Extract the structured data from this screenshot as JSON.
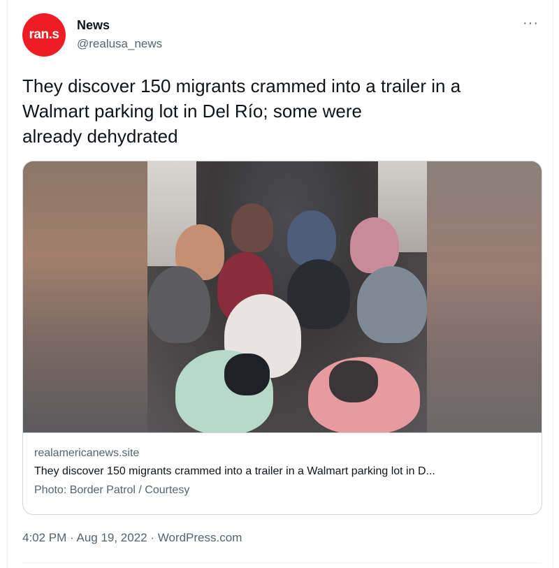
{
  "author": {
    "avatar_text": "ran.s",
    "name": "News",
    "handle": "@realusa_news"
  },
  "more_glyph": "···",
  "tweet": {
    "text_lines": [
      "They discover 150 migrants crammed into a trailer in a",
      "Walmart parking lot in Del Río; some were",
      "already dehydrated"
    ]
  },
  "card": {
    "domain": "realamericanews.site",
    "title": "They discover 150 migrants crammed into a trailer in a Walmart parking lot in D...",
    "description": "Photo: Border Patrol / Courtesy"
  },
  "meta": {
    "time": "4:02 PM",
    "separator": " · ",
    "date": "Aug 19, 2022",
    "source": "WordPress.com"
  },
  "colors": {
    "avatar_bg": "#ee1c25",
    "secondary_text": "#536471",
    "primary_text": "#0f1419",
    "border": "#cfd9de"
  }
}
